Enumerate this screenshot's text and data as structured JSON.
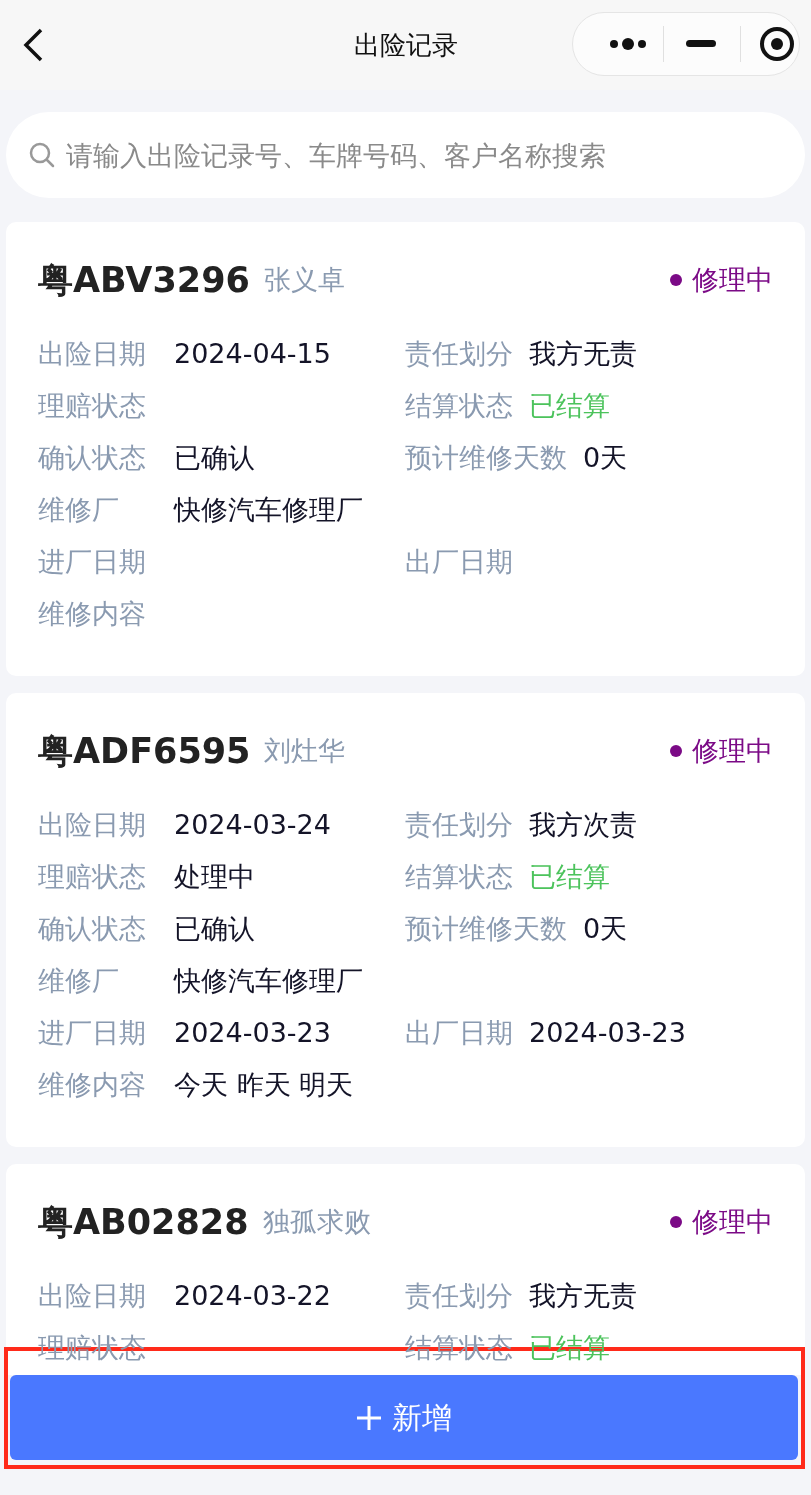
{
  "nav": {
    "title": "出险记录"
  },
  "search": {
    "placeholder": "请输入出险记录号、车牌号码、客户名称搜索"
  },
  "records": [
    {
      "plate": "粤ABV3296",
      "customer": "张义卓",
      "status": {
        "label": "修理中",
        "color": "#7b0a86"
      },
      "rows": [
        [
          {
            "label": "出险日期",
            "value": "2024-04-15"
          },
          {
            "label": "责任划分",
            "value": "我方无责"
          }
        ],
        [
          {
            "label": "理赔状态"
          },
          {
            "label": "结算状态",
            "value": "已结算",
            "positive": true
          }
        ],
        [
          {
            "label": "确认状态",
            "value": "已确认"
          },
          {
            "label": "预计维修天数",
            "value": "0天"
          }
        ],
        [
          {
            "label": "维修厂",
            "value": "快修汽车修理厂"
          }
        ],
        [
          {
            "label": "进厂日期"
          },
          {
            "label": "出厂日期"
          }
        ],
        [
          {
            "label": "维修内容"
          }
        ]
      ]
    },
    {
      "plate": "粤ADF6595",
      "customer": "刘灶华",
      "status": {
        "label": "修理中",
        "color": "#7b0a86"
      },
      "rows": [
        [
          {
            "label": "出险日期",
            "value": "2024-03-24"
          },
          {
            "label": "责任划分",
            "value": "我方次责"
          }
        ],
        [
          {
            "label": "理赔状态",
            "value": "处理中"
          },
          {
            "label": "结算状态",
            "value": "已结算",
            "positive": true
          }
        ],
        [
          {
            "label": "确认状态",
            "value": "已确认"
          },
          {
            "label": "预计维修天数",
            "value": "0天"
          }
        ],
        [
          {
            "label": "维修厂",
            "value": "快修汽车修理厂"
          }
        ],
        [
          {
            "label": "进厂日期",
            "value": "2024-03-23"
          },
          {
            "label": "出厂日期",
            "value": "2024-03-23"
          }
        ],
        [
          {
            "label": "维修内容",
            "value": "今天 昨天 明天"
          }
        ]
      ]
    },
    {
      "plate": "粤AB02828",
      "customer": "独孤求败",
      "status": {
        "label": "修理中",
        "color": "#7b0a86"
      },
      "rows": [
        [
          {
            "label": "出险日期",
            "value": "2024-03-22"
          },
          {
            "label": "责任划分",
            "value": "我方无责"
          }
        ],
        [
          {
            "label": "理赔状态"
          },
          {
            "label": "结算状态",
            "value": "已结算",
            "positive": true
          }
        ]
      ]
    }
  ],
  "add_button": {
    "label": "新增",
    "highlighted": true
  }
}
